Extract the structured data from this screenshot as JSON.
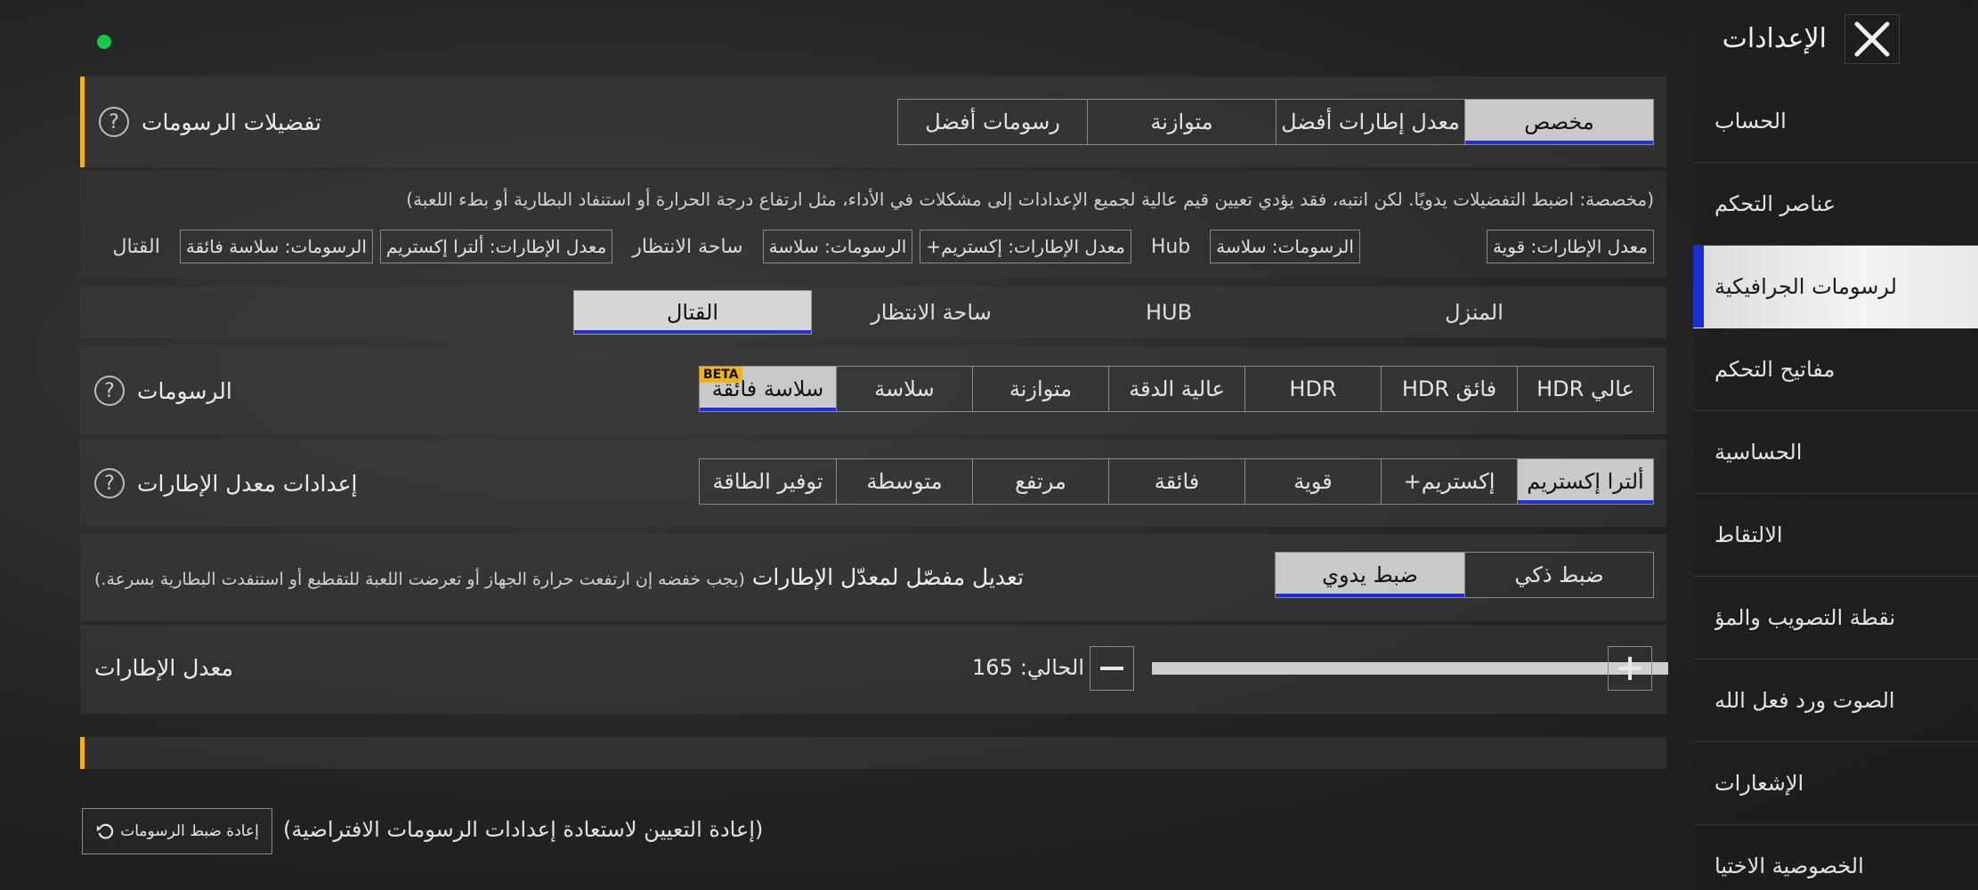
{
  "header": {
    "title": "الإعدادات"
  },
  "sidebar": {
    "items": [
      {
        "label": "الحساب"
      },
      {
        "label": "عناصر التحكم"
      },
      {
        "label": "لرسومات الجرافيكية"
      },
      {
        "label": "مفاتيح التحكم"
      },
      {
        "label": "الحساسية"
      },
      {
        "label": "الالتقاط"
      },
      {
        "label": "نقطة التصويب والمؤ"
      },
      {
        "label": "الصوت ورد فعل الله"
      },
      {
        "label": "الإشعارات"
      },
      {
        "label": "الخصوصية الاختيا"
      }
    ]
  },
  "graphics_pref": {
    "label": "تفضيلات الرسومات",
    "options": [
      "مخصص",
      "معدل إطارات أفضل",
      "متوازنة",
      "رسومات أفضل"
    ],
    "selected": "مخصص",
    "note": "(مخصصة: اضبط التفضيلات يدويًا. لكن انتبه، فقد يؤدي تعيين قيم عالية لجميع الإعدادات إلى مشكلات في الأداء، مثل ارتفاع درجة الحرارة أو استنفاد البطارية أو بطء اللعبة)",
    "summary": [
      {
        "type": "chip",
        "text": "معدل الإطارات: قوية"
      },
      {
        "type": "chip",
        "text": "الرسومات: سلاسة"
      },
      {
        "type": "plain",
        "text": "Hub"
      },
      {
        "type": "chip",
        "text": "معدل الإطارات: إكستريم+"
      },
      {
        "type": "chip",
        "text": "الرسومات: سلاسة"
      },
      {
        "type": "plain",
        "text": "ساحة الانتظار"
      },
      {
        "type": "chip",
        "text": "معدل الإطارات: ألترا إكستريم"
      },
      {
        "type": "chip",
        "text": "الرسومات: سلاسة فائقة"
      },
      {
        "type": "plain",
        "text": "القتال"
      }
    ]
  },
  "mode_tabs": {
    "tabs": [
      "المنزل",
      "HUB",
      "ساحة الانتظار",
      "القتال"
    ],
    "selected": "القتال"
  },
  "graphics": {
    "label": "الرسومات",
    "options": [
      "عالي HDR",
      "فائق HDR",
      "HDR",
      "عالية الدقة",
      "متوازنة",
      "سلاسة",
      "سلاسة فائقة"
    ],
    "selected": "سلاسة فائقة",
    "beta_badge": "BETA"
  },
  "fps_settings": {
    "label": "إعدادات معدل الإطارات",
    "options": [
      "ألترا إكستريم",
      "إكستريم+",
      "قوية",
      "فائقة",
      "مرتفع",
      "متوسطة",
      "توفير الطاقة"
    ],
    "selected": "ألترا إكستريم"
  },
  "fine_tune": {
    "label_bold": "تعديل مفصّل لمعدّل الإطارات",
    "label_note": "(يجب خفضه إن ارتفعت حرارة الجهاز أو تعرضت اللعبة للتقطيع أو استنفدت البطارية بسرعة.)",
    "options": [
      "ضبط ذكي",
      "ضبط يدوي"
    ],
    "selected": "ضبط يدوي"
  },
  "fps": {
    "label": "معدل الإطارات",
    "current_label": "الحالي:",
    "current_value": "165",
    "slider_fraction": 1.0
  },
  "reset": {
    "button_label": "إعادة ضبط الرسومات",
    "note": "(إعادة التعيين لاستعادة إعدادات الرسومات الافتراضية)"
  },
  "colors": {
    "accent_blue": "#2430c8",
    "section_marker": "#f3b21b",
    "status_green": "#19c94a"
  }
}
